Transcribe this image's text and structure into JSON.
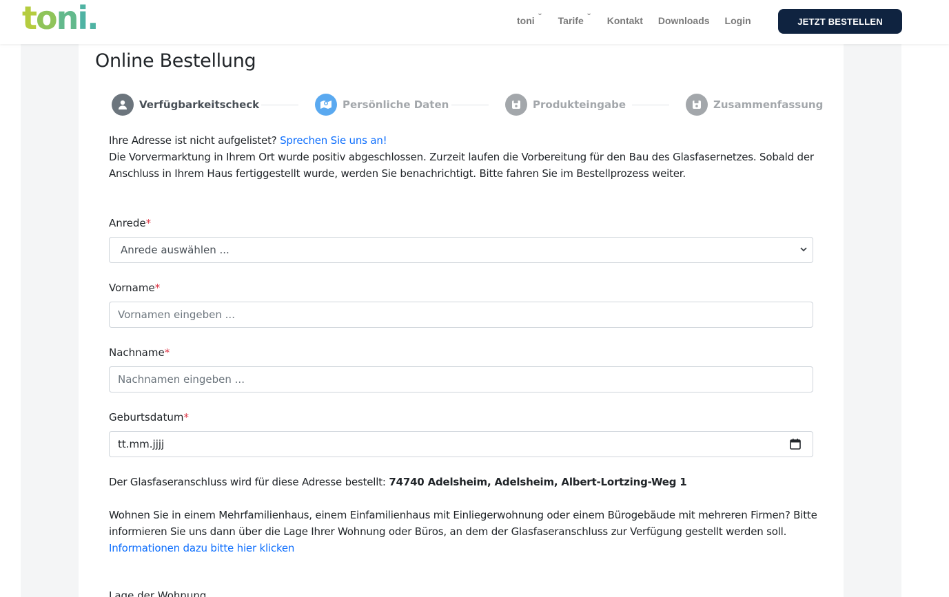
{
  "header": {
    "logo": "toni.",
    "nav": [
      {
        "label": "toni",
        "dropdown": true
      },
      {
        "label": "Tarife",
        "dropdown": true
      },
      {
        "label": "Kontakt",
        "dropdown": false
      },
      {
        "label": "Downloads",
        "dropdown": false
      },
      {
        "label": "Login",
        "dropdown": false
      }
    ],
    "cta_label": "JETZT BESTELLEN"
  },
  "page": {
    "title": "Online Bestellung",
    "steps": [
      {
        "label": "Verfügbarkeitscheck",
        "icon": "user-icon",
        "state": "done"
      },
      {
        "label": "Persönliche Daten",
        "icon": "map-icon",
        "state": "active"
      },
      {
        "label": "Produkteingabe",
        "icon": "save-icon",
        "state": "pending"
      },
      {
        "label": "Zusammenfassung",
        "icon": "save-icon",
        "state": "pending"
      }
    ],
    "notice_prefix": "Ihre Adresse ist nicht aufgelistet?",
    "notice_link": "Sprechen Sie uns an!",
    "notice_line2": "Die Vorvermarktung in Ihrem Ort wurde positiv abgeschlossen. Zurzeit laufen die Vorbereitung für den Bau des Glasfasernetzes. Sobald der",
    "notice_line3": "Anschluss in Ihrem Haus fertiggestellt wurde, werden Sie benachrichtigt. Bitte fahren Sie im Bestellprozess weiter."
  },
  "form": {
    "anrede": {
      "label": "Anrede",
      "required_mark": "*",
      "value": "Anrede auswählen ..."
    },
    "vorname": {
      "label": "Vorname",
      "required_mark": "*",
      "placeholder": "Vornamen eingeben ..."
    },
    "nachname": {
      "label": "Nachname",
      "required_mark": "*",
      "placeholder": "Nachnamen eingeben ..."
    },
    "geburtsdatum": {
      "label": "Geburtsdatum",
      "required_mark": "*",
      "placeholder": "tt.mm.jjjj"
    }
  },
  "address": {
    "prefix": "Der Glasfaseranschluss wird für diese Adresse bestellt:",
    "value": "74740 Adelsheim, Adelsheim, Albert-Lortzing-Weg 1"
  },
  "info": {
    "line1": "Wohnen Sie in einem Mehrfamilienhaus, einem Einfamilienhaus mit Einliegerwohnung oder einem Bürogebäude mit mehreren Firmen? Bitte",
    "line2": "informieren Sie uns dann über die Lage Ihrer Wohnung oder Büros, an dem der Glasfaseranschluss zur Verfügung gestellt werden soll.",
    "link": "Informationen dazu bitte hier klicken",
    "cut_label": "Lage der Wohnung"
  },
  "colors": {
    "cta_bg": "#0f2340",
    "link": "#0d6efd",
    "required": "#dc3545",
    "step_active": "#5aa9f0"
  }
}
